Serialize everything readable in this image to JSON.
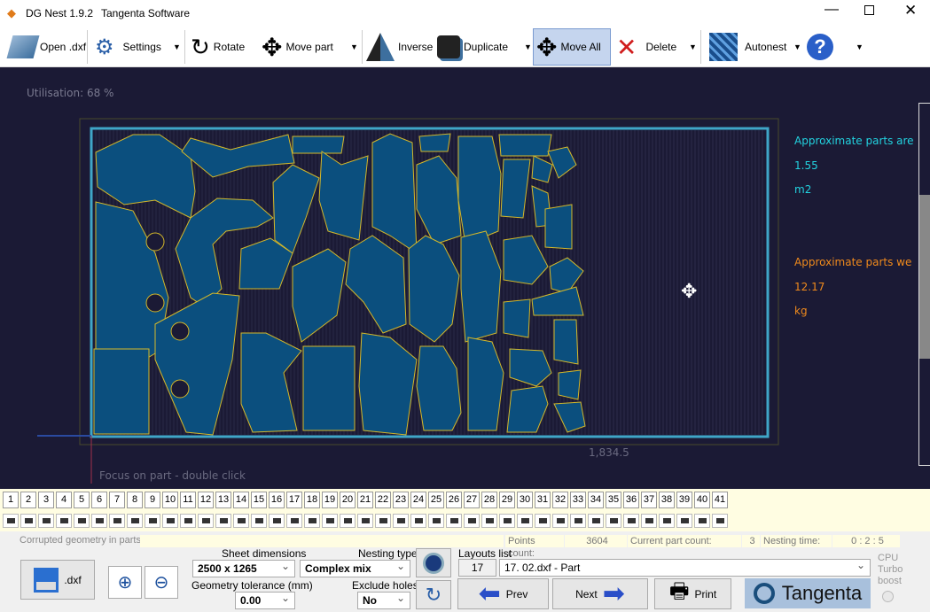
{
  "window": {
    "app_title": "DG Nest 1.9.2",
    "company": "Tangenta Software"
  },
  "toolbar": {
    "open": "Open .dxf",
    "settings": "Settings",
    "rotate": "Rotate",
    "move_part": "Move part",
    "inverse": "Inverse",
    "duplicate": "Duplicate",
    "move_all": "Move All",
    "delete": "Delete",
    "autonest": "Autonest"
  },
  "canvas": {
    "utilisation": "Utilisation: 68 %",
    "focus_hint": "Focus on part - double click",
    "dimension": "1,834.5",
    "area_label": "Approximate parts are",
    "area_value": "1.55",
    "area_unit": "m2",
    "weight_label": "Approximate parts we",
    "weight_value": "12.17",
    "weight_unit": "kg"
  },
  "layout_tabs": [
    "1",
    "2",
    "3",
    "4",
    "5",
    "6",
    "7",
    "8",
    "9",
    "10",
    "11",
    "12",
    "13",
    "14",
    "15",
    "16",
    "17",
    "18",
    "19",
    "20",
    "21",
    "22",
    "23",
    "24",
    "25",
    "26",
    "27",
    "28",
    "29",
    "30",
    "31",
    "32",
    "33",
    "34",
    "35",
    "36",
    "37",
    "38",
    "39",
    "40",
    "41"
  ],
  "status": {
    "corrupted_label": "Corrupted geometry in parts:",
    "points_label": "Points count:",
    "points_value": "3604",
    "part_count_label": "Current part count:",
    "part_count_value": "3",
    "nesting_time_label": "Nesting time:",
    "nesting_time_value": "0 : 2 : 5"
  },
  "bottom": {
    "save_dxf": ".dxf",
    "sheet_dim_label": "Sheet dimensions",
    "sheet_dim_value": "2500 x 1265",
    "nesting_type_label": "Nesting type",
    "nesting_type_value": "Complex mix",
    "tolerance_label": "Geometry tolerance (mm)",
    "tolerance_value": "0.00",
    "exclude_holes_label": "Exclude holes",
    "exclude_holes_value": "No",
    "layouts_label": "Layouts list",
    "layout_index": "17",
    "layout_value": "17. 02.dxf - Part",
    "prev": "Prev",
    "next": "Next",
    "print": "Print",
    "brand": "Tangenta",
    "cpu_label": "CPU Turbo boost"
  },
  "colors": {
    "canvas_bg": "#1b1a35",
    "part_fill": "#0b4f7e",
    "part_stroke": "#d4b82a",
    "sheet_border": "#3fa6c8",
    "area_text": "#22d3e0",
    "weight_text": "#f08a1c"
  }
}
